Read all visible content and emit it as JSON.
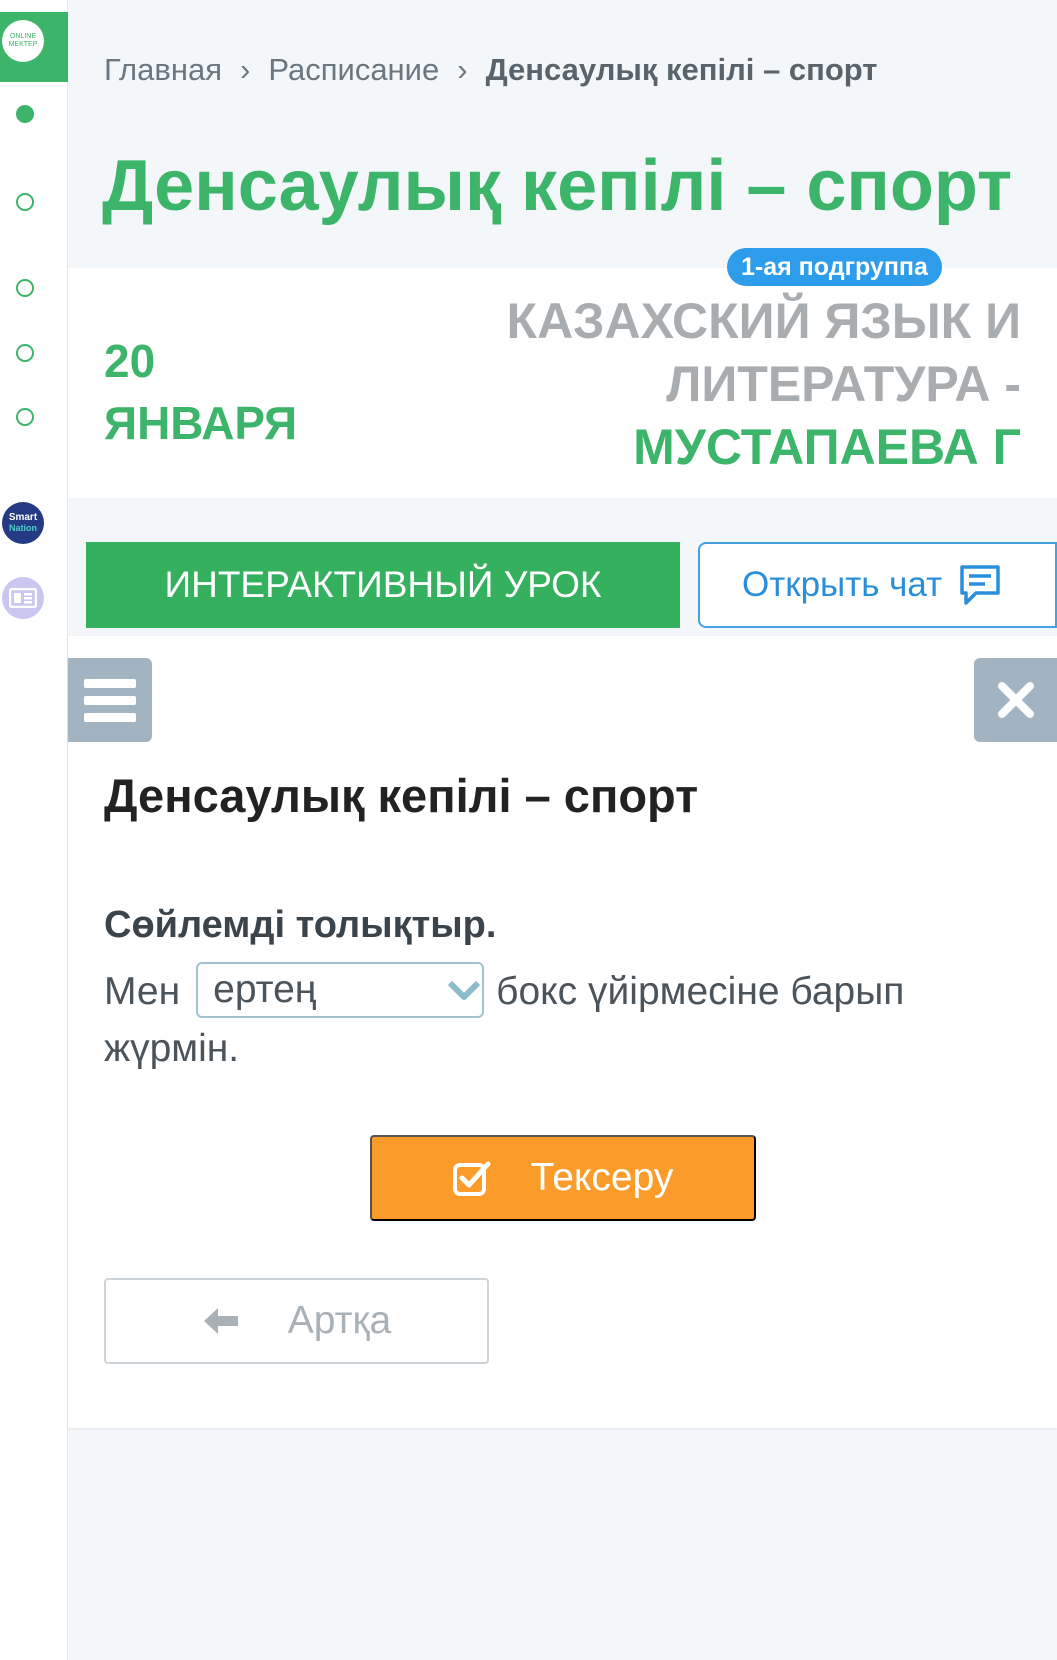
{
  "colors": {
    "brand_green": "#3cb46a",
    "badge_blue": "#2c9ceb",
    "check_orange": "#fb9c2a",
    "muted_gray": "#a9adb0"
  },
  "sidebar": {
    "logo_text_line1": "ONLINE",
    "logo_text_line2": "MEKTEP",
    "smart_line1": "Smart",
    "smart_line2": "Nation"
  },
  "breadcrumb": {
    "items": [
      "Главная",
      "Расписание"
    ],
    "current": "Денсаулық кепілі – спорт",
    "separator": "›"
  },
  "page_title": "Денсаулық кепілі – спорт",
  "lesson": {
    "date_day": "20",
    "date_month": "ЯНВАРЯ",
    "subgroup_badge": "1-ая подгруппа",
    "subject_line1": "КАЗАХСКИЙ ЯЗЫК И",
    "subject_line2": "ЛИТЕРАТУРА -",
    "teacher": "МУСТАПАЕВА Г"
  },
  "actions": {
    "interactive_label": "ИНТЕРАКТИВНЫЙ УРОК",
    "chat_label": "Открыть чат"
  },
  "card": {
    "title": "Денсаулық кепілі – спорт",
    "task_title": "Сөйлемді толықтыр.",
    "sentence_before": "Мен",
    "select_value": "ертең",
    "sentence_after": "бокс үйірмесіне барып жүрмін.",
    "check_label": "Тексеру",
    "back_label": "Артқа"
  }
}
